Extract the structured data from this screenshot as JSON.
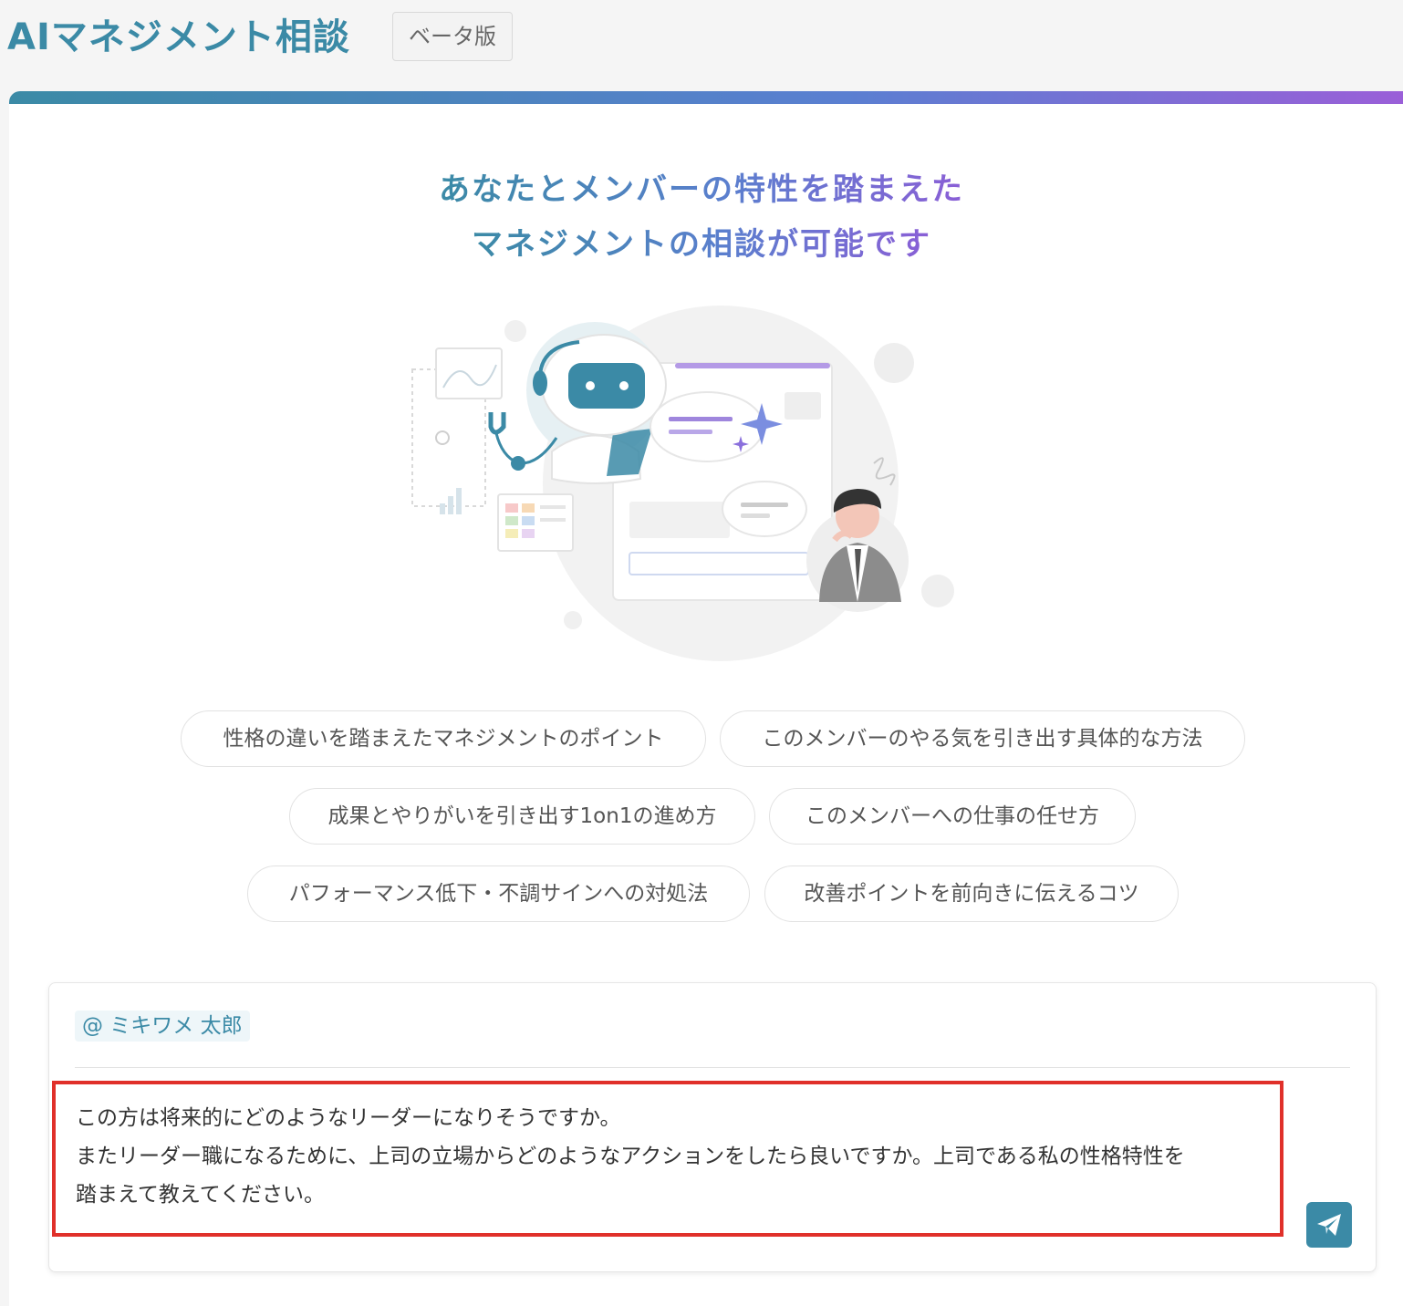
{
  "header": {
    "title": "AIマネジメント相談",
    "badge": "ベータ版"
  },
  "hero": {
    "headline_line1": "あなたとメンバーの特性を踏まえた",
    "headline_line2": "マネジメントの相談が可能です"
  },
  "suggestions": [
    "性格の違いを踏まえたマネジメントのポイント",
    "このメンバーのやる気を引き出す具体的な方法",
    "成果とやりがいを引き出す1on1の進め方",
    "このメンバーへの仕事の任せ方",
    "パフォーマンス低下・不調サインへの対処法",
    "改善ポイントを前向きに伝えるコツ"
  ],
  "composer": {
    "mention": "@ ミキワメ 太郎",
    "message_lines": [
      "この方は将来的にどのようなリーダーになりそうですか。",
      "またリーダー職になるために、上司の立場からどのようなアクションをしたら良いですか。上司である私の性格特性を",
      "踏まえて教えてください。"
    ],
    "send_icon": "paper-plane-icon"
  },
  "colors": {
    "accent": "#3b8aa6",
    "accent_purple": "#8a5fd6",
    "highlight_border": "#e0302a"
  }
}
